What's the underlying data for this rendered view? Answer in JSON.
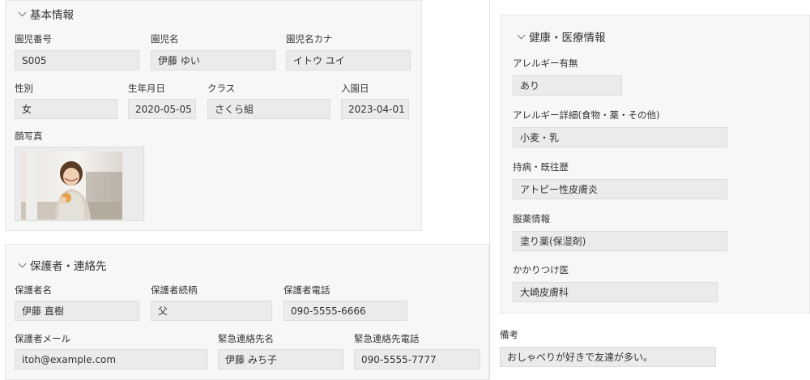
{
  "basic": {
    "title": "基本情報",
    "fields": {
      "child_no": {
        "label": "園児番号",
        "value": "S005"
      },
      "child_name": {
        "label": "園児名",
        "value": "伊藤 ゆい"
      },
      "child_kana": {
        "label": "園児名カナ",
        "value": "イトウ ユイ"
      },
      "gender": {
        "label": "性別",
        "value": "女"
      },
      "birthday": {
        "label": "生年月日",
        "value": "2020-05-05"
      },
      "class": {
        "label": "クラス",
        "value": "さくら組"
      },
      "enroll_date": {
        "label": "入園日",
        "value": "2023-04-01"
      },
      "photo": {
        "label": "顔写真"
      }
    }
  },
  "guardian": {
    "title": "保護者・連絡先",
    "fields": {
      "name": {
        "label": "保護者名",
        "value": "伊藤 直樹"
      },
      "relation": {
        "label": "保護者続柄",
        "value": "父"
      },
      "phone": {
        "label": "保護者電話",
        "value": "090-5555-6666"
      },
      "email": {
        "label": "保護者メール",
        "value": "itoh@example.com"
      },
      "emergency_name": {
        "label": "緊急連絡先名",
        "value": "伊藤 みち子"
      },
      "emergency_phone": {
        "label": "緊急連絡先電話",
        "value": "090-5555-7777"
      }
    }
  },
  "health": {
    "title": "健康・医療情報",
    "fields": {
      "allergy": {
        "label": "アレルギー有無",
        "value": "あり"
      },
      "allergy_detail": {
        "label": "アレルギー詳細(食物・薬・その他)",
        "value": "小麦・乳"
      },
      "chronic": {
        "label": "持病・既往歴",
        "value": "アトピー性皮膚炎"
      },
      "medication": {
        "label": "服薬情報",
        "value": "塗り薬(保湿剤)"
      },
      "doctor": {
        "label": "かかりつけ医",
        "value": "大崎皮膚科"
      }
    }
  },
  "notes": {
    "label": "備考",
    "value": "おしゃべりが好きで友達が多い。"
  }
}
